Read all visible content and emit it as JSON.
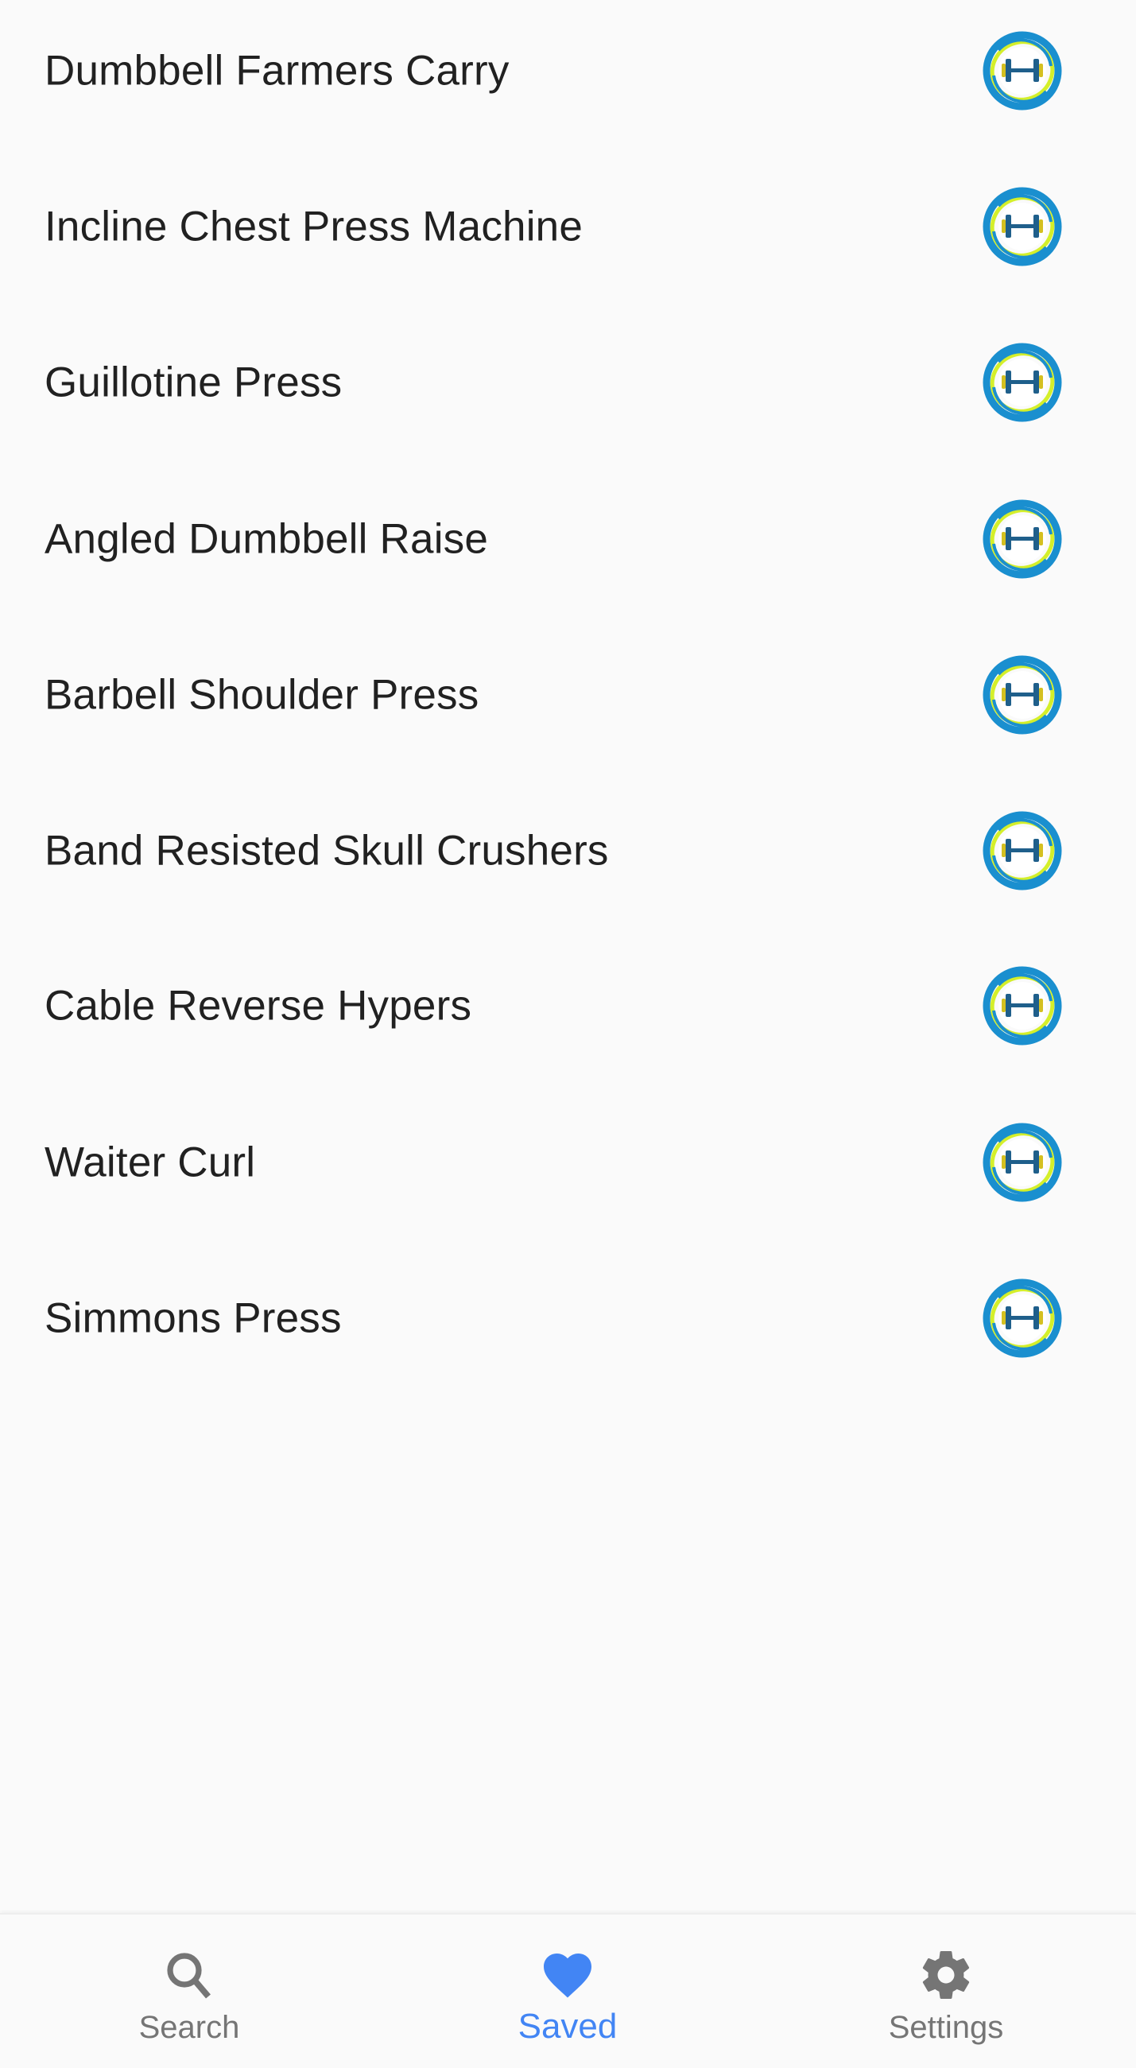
{
  "saved_exercises": [
    {
      "name": "Dumbbell Farmers Carry",
      "icon": "dumbbell-logo-icon"
    },
    {
      "name": "Incline Chest Press Machine",
      "icon": "dumbbell-logo-icon"
    },
    {
      "name": "Guillotine Press",
      "icon": "dumbbell-logo-icon"
    },
    {
      "name": "Angled Dumbbell Raise",
      "icon": "dumbbell-logo-icon"
    },
    {
      "name": "Barbell Shoulder Press",
      "icon": "dumbbell-logo-icon"
    },
    {
      "name": "Band Resisted Skull Crushers",
      "icon": "dumbbell-logo-icon"
    },
    {
      "name": "Cable Reverse Hypers",
      "icon": "dumbbell-logo-icon"
    },
    {
      "name": "Waiter Curl",
      "icon": "dumbbell-logo-icon"
    },
    {
      "name": "Simmons Press",
      "icon": "dumbbell-logo-icon"
    }
  ],
  "bottom_nav": {
    "items": [
      {
        "label": "Search",
        "icon": "search-icon",
        "active": false
      },
      {
        "label": "Saved",
        "icon": "heart-icon",
        "active": true
      },
      {
        "label": "Settings",
        "icon": "gear-icon",
        "active": false
      }
    ],
    "active_color": "#4285f4",
    "inactive_color": "#757575"
  },
  "colors": {
    "logo_blue": "#1a8fcf",
    "logo_yellow": "#d4ef2a",
    "logo_dumbbell": "#1f5f8b",
    "text": "#212121",
    "background": "#fafafa"
  }
}
